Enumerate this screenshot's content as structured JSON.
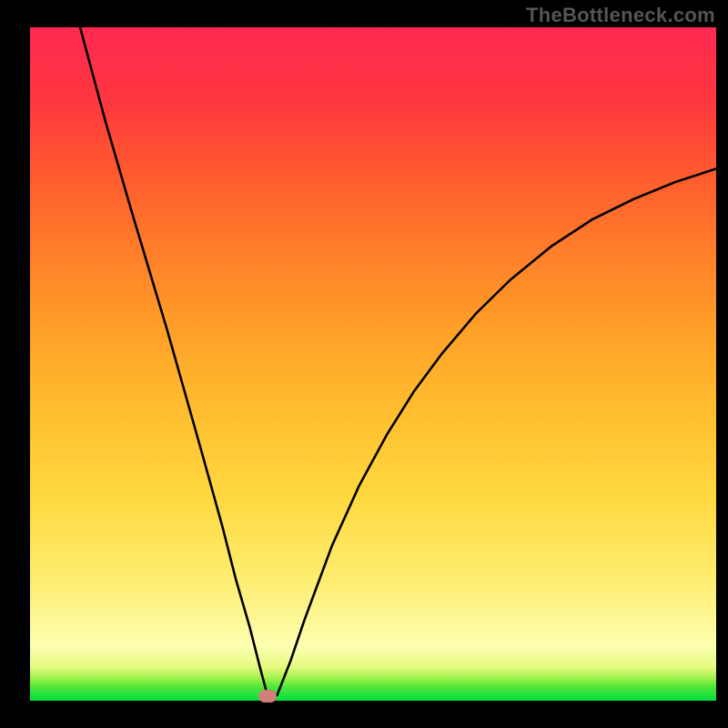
{
  "watermark_text": "TheBottleneck.com",
  "chart_data": {
    "type": "line",
    "title": "",
    "xlabel": "",
    "ylabel": "",
    "xlim": [
      0,
      100
    ],
    "ylim": [
      0,
      100
    ],
    "grid": false,
    "series": [
      {
        "name": "curve",
        "x": [
          7.3,
          11,
          15,
          20,
          25,
          28,
          30,
          32,
          33.5,
          34.6,
          36,
          38,
          40,
          44,
          48,
          52,
          56,
          60,
          65,
          70,
          76,
          82,
          88,
          94,
          100
        ],
        "y": [
          100,
          86,
          72,
          55,
          37,
          26,
          18,
          11,
          5,
          0.8,
          0.8,
          6,
          12,
          23,
          32,
          39.5,
          46,
          51.5,
          57.5,
          62.5,
          67.5,
          71.5,
          74.5,
          77,
          79
        ]
      }
    ],
    "marker": {
      "x": 34.6,
      "y": 0.7
    },
    "background": "rainbow_green_to_red",
    "line_color": "#000000",
    "line_width": 2.6
  }
}
